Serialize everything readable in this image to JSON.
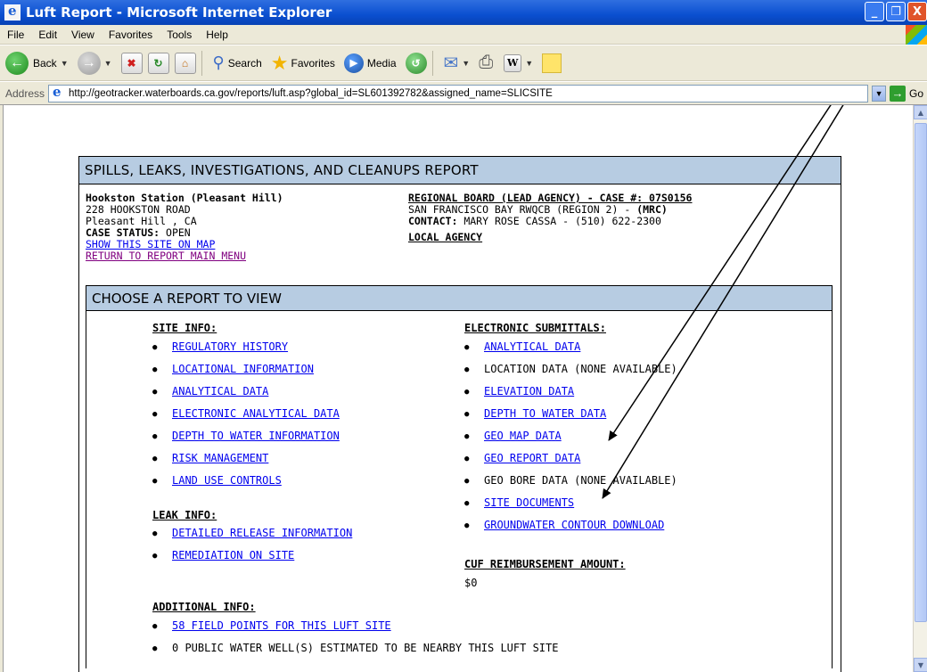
{
  "window": {
    "title": "Luft Report - Microsoft Internet Explorer",
    "controls": [
      "_",
      "❐",
      "X"
    ]
  },
  "menu": [
    "File",
    "Edit",
    "View",
    "Favorites",
    "Tools",
    "Help"
  ],
  "toolbar": {
    "back_label": "Back",
    "search_label": "Search",
    "favorites_label": "Favorites",
    "media_label": "Media"
  },
  "address": {
    "label": "Address",
    "url": "http://geotracker.waterboards.ca.gov/reports/luft.asp?global_id=SL601392782&assigned_name=SLICSITE",
    "go_label": "Go"
  },
  "report": {
    "title": "SPILLS, LEAKS, INVESTIGATIONS, AND CLEANUPS REPORT",
    "site": {
      "name": "Hookston Station (Pleasant Hill)",
      "street": "228 HOOKSTON ROAD",
      "city": "Pleasant Hill , CA",
      "status_label": "CASE STATUS:",
      "status_value": "OPEN",
      "map_link": "SHOW THIS SITE ON MAP",
      "return_link": "RETURN TO REPORT MAIN MENU"
    },
    "agency": {
      "heading": "REGIONAL BOARD (LEAD AGENCY) - CASE #: 07S0156",
      "board": "SAN FRANCISCO BAY RWQCB (REGION 2) -",
      "board_code": "(MRC)",
      "contact_label": "CONTACT:",
      "contact_value": "MARY ROSE CASSA - (510) 622-2300",
      "local_agency": "LOCAL AGENCY"
    },
    "choose": {
      "title": "CHOOSE A REPORT TO VIEW",
      "site_info": {
        "heading": "SITE INFO:",
        "items": [
          "REGULATORY HISTORY",
          "LOCATIONAL INFORMATION",
          "ANALYTICAL DATA",
          "ELECTRONIC ANALYTICAL DATA",
          "DEPTH TO WATER INFORMATION",
          "RISK MANAGEMENT",
          "LAND USE CONTROLS"
        ]
      },
      "leak_info": {
        "heading": "LEAK INFO:",
        "items": [
          "DETAILED RELEASE INFORMATION",
          "REMEDIATION ON SITE"
        ]
      },
      "additional_info": {
        "heading": "ADDITIONAL INFO:",
        "field_points": "58 FIELD POINTS FOR THIS LUFT SITE",
        "water_wells": "0 PUBLIC WATER WELL(S) ESTIMATED TO BE NEARBY THIS LUFT SITE"
      },
      "electronic_submittals": {
        "heading": "ELECTRONIC SUBMITTALS:",
        "items": [
          "ANALYTICAL DATA",
          "LOCATION DATA (NONE AVAILABLE)",
          "ELEVATION DATA",
          "DEPTH TO WATER DATA",
          "GEO MAP DATA",
          "GEO REPORT DATA",
          "GEO BORE DATA (NONE AVAILABLE)",
          "SITE DOCUMENTS",
          "GROUNDWATER CONTOUR DOWNLOAD"
        ]
      },
      "cuf": {
        "heading": "CUF REIMBURSEMENT AMOUNT:",
        "value": "$0"
      }
    }
  }
}
